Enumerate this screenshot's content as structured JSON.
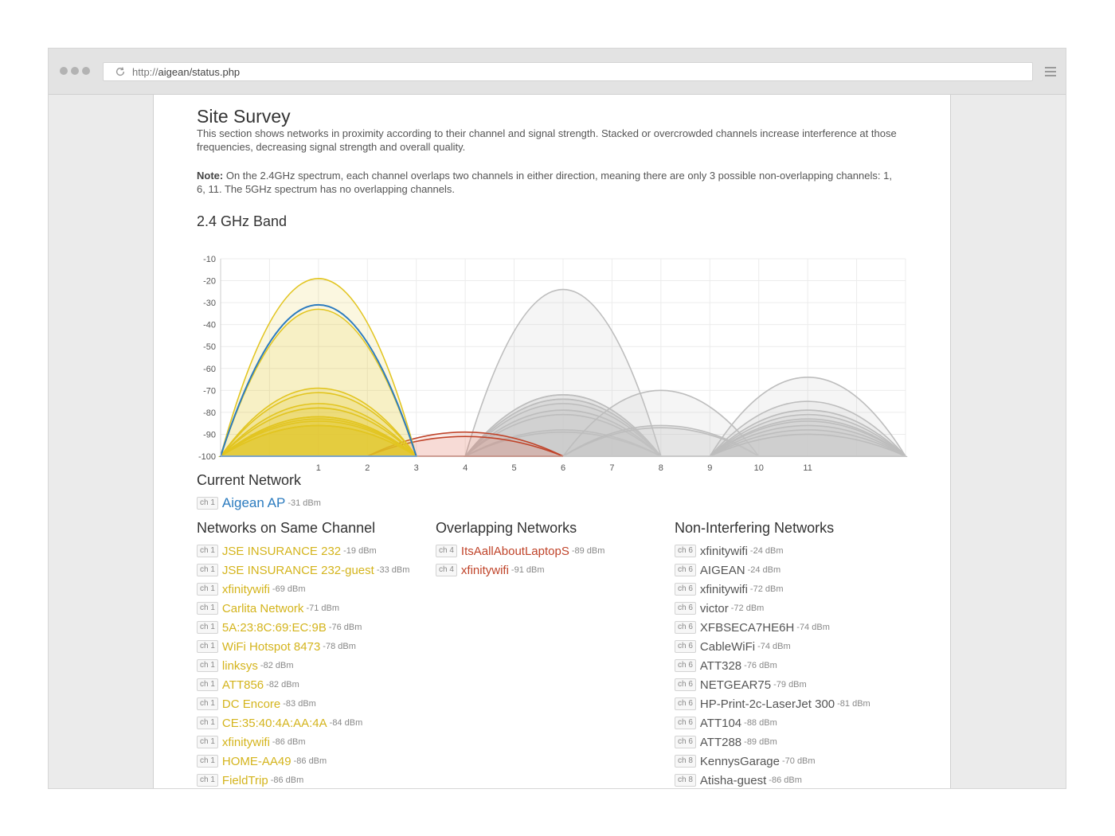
{
  "browser": {
    "url_scheme": "http://",
    "url_host": "aigean/status.php"
  },
  "page": {
    "title": "Site Survey",
    "description": "This section shows networks in proximity according to their channel and signal strength. Stacked or overcrowded channels increase interference at those frequencies, decreasing signal strength and overall quality.",
    "note_label": "Note:",
    "note_text": " On the 2.4GHz spectrum, each channel overlaps two channels in either direction, meaning there are only 3 possible non-overlapping channels: 1, 6, 11. The 5GHz spectrum has no overlapping channels.",
    "band_title": "2.4 GHz Band"
  },
  "colors": {
    "current": "#2b7bbf",
    "same": "#e2c521",
    "overlap": "#c0442a",
    "non_interfering": "#bdbdbd",
    "grid": "#ececec"
  },
  "chart_data": {
    "type": "area",
    "x_ticks": [
      "1",
      "2",
      "3",
      "4",
      "5",
      "6",
      "7",
      "8",
      "9",
      "10",
      "11"
    ],
    "y_ticks": [
      "-10",
      "-20",
      "-30",
      "-40",
      "-50",
      "-60",
      "-70",
      "-80",
      "-90",
      "-100"
    ],
    "xlim": [
      -1,
      13
    ],
    "ylim": [
      -100,
      -10
    ],
    "grid": true,
    "series": [
      {
        "channel": 1,
        "dbm": -19,
        "group": "same"
      },
      {
        "channel": 1,
        "dbm": -33,
        "group": "same"
      },
      {
        "channel": 1,
        "dbm": -69,
        "group": "same"
      },
      {
        "channel": 1,
        "dbm": -71,
        "group": "same"
      },
      {
        "channel": 1,
        "dbm": -76,
        "group": "same"
      },
      {
        "channel": 1,
        "dbm": -78,
        "group": "same"
      },
      {
        "channel": 1,
        "dbm": -82,
        "group": "same"
      },
      {
        "channel": 1,
        "dbm": -82,
        "group": "same"
      },
      {
        "channel": 1,
        "dbm": -83,
        "group": "same"
      },
      {
        "channel": 1,
        "dbm": -84,
        "group": "same"
      },
      {
        "channel": 1,
        "dbm": -86,
        "group": "same"
      },
      {
        "channel": 1,
        "dbm": -86,
        "group": "same"
      },
      {
        "channel": 1,
        "dbm": -86,
        "group": "same"
      },
      {
        "channel": 1,
        "dbm": -31,
        "group": "current"
      },
      {
        "channel": 4,
        "dbm": -89,
        "group": "overlap"
      },
      {
        "channel": 4,
        "dbm": -91,
        "group": "overlap"
      },
      {
        "channel": 6,
        "dbm": -24,
        "group": "non"
      },
      {
        "channel": 6,
        "dbm": -72,
        "group": "non"
      },
      {
        "channel": 6,
        "dbm": -72,
        "group": "non"
      },
      {
        "channel": 6,
        "dbm": -74,
        "group": "non"
      },
      {
        "channel": 6,
        "dbm": -74,
        "group": "non"
      },
      {
        "channel": 6,
        "dbm": -76,
        "group": "non"
      },
      {
        "channel": 6,
        "dbm": -79,
        "group": "non"
      },
      {
        "channel": 6,
        "dbm": -81,
        "group": "non"
      },
      {
        "channel": 6,
        "dbm": -88,
        "group": "non"
      },
      {
        "channel": 6,
        "dbm": -89,
        "group": "non"
      },
      {
        "channel": 8,
        "dbm": -70,
        "group": "non"
      },
      {
        "channel": 8,
        "dbm": -86,
        "group": "non"
      },
      {
        "channel": 8,
        "dbm": -87,
        "group": "non"
      },
      {
        "channel": 11,
        "dbm": -64,
        "group": "non"
      },
      {
        "channel": 11,
        "dbm": -75,
        "group": "non"
      },
      {
        "channel": 11,
        "dbm": -79,
        "group": "non"
      },
      {
        "channel": 11,
        "dbm": -81,
        "group": "non"
      },
      {
        "channel": 11,
        "dbm": -83,
        "group": "non"
      },
      {
        "channel": 11,
        "dbm": -84,
        "group": "non"
      },
      {
        "channel": 11,
        "dbm": -86,
        "group": "non"
      },
      {
        "channel": 11,
        "dbm": -88,
        "group": "non"
      },
      {
        "channel": 11,
        "dbm": -90,
        "group": "non"
      }
    ]
  },
  "current_network": {
    "title": "Current Network",
    "channel": "ch 1",
    "name": "Aigean AP",
    "dbm": "-31 dBm"
  },
  "same_channel": {
    "title": "Networks on Same Channel",
    "items": [
      {
        "channel": "ch 1",
        "name": "JSE INSURANCE 232",
        "dbm": "-19 dBm"
      },
      {
        "channel": "ch 1",
        "name": "JSE INSURANCE 232-guest",
        "dbm": "-33 dBm"
      },
      {
        "channel": "ch 1",
        "name": "xfinitywifi",
        "dbm": "-69 dBm"
      },
      {
        "channel": "ch 1",
        "name": "Carlita Network",
        "dbm": "-71 dBm"
      },
      {
        "channel": "ch 1",
        "name": "5A:23:8C:69:EC:9B",
        "dbm": "-76 dBm"
      },
      {
        "channel": "ch 1",
        "name": "WiFi Hotspot 8473",
        "dbm": "-78 dBm"
      },
      {
        "channel": "ch 1",
        "name": "linksys",
        "dbm": "-82 dBm"
      },
      {
        "channel": "ch 1",
        "name": "ATT856",
        "dbm": "-82 dBm"
      },
      {
        "channel": "ch 1",
        "name": "DC Encore",
        "dbm": "-83 dBm"
      },
      {
        "channel": "ch 1",
        "name": "CE:35:40:4A:AA:4A",
        "dbm": "-84 dBm"
      },
      {
        "channel": "ch 1",
        "name": "xfinitywifi",
        "dbm": "-86 dBm"
      },
      {
        "channel": "ch 1",
        "name": "HOME-AA49",
        "dbm": "-86 dBm"
      },
      {
        "channel": "ch 1",
        "name": "FieldTrip",
        "dbm": "-86 dBm"
      }
    ]
  },
  "overlapping": {
    "title": "Overlapping Networks",
    "items": [
      {
        "channel": "ch 4",
        "name": "ItsAallAboutLaptopS",
        "dbm": "-89 dBm"
      },
      {
        "channel": "ch 4",
        "name": "xfinitywifi",
        "dbm": "-91 dBm"
      }
    ]
  },
  "non_interfering": {
    "title": "Non-Interfering Networks",
    "items": [
      {
        "channel": "ch 6",
        "name": "xfinitywifi",
        "dbm": "-24 dBm"
      },
      {
        "channel": "ch 6",
        "name": "AIGEAN",
        "dbm": "-24 dBm"
      },
      {
        "channel": "ch 6",
        "name": "xfinitywifi",
        "dbm": "-72 dBm"
      },
      {
        "channel": "ch 6",
        "name": "victor",
        "dbm": "-72 dBm"
      },
      {
        "channel": "ch 6",
        "name": "XFBSECA7HE6H",
        "dbm": "-74 dBm"
      },
      {
        "channel": "ch 6",
        "name": "CableWiFi",
        "dbm": "-74 dBm"
      },
      {
        "channel": "ch 6",
        "name": "ATT328",
        "dbm": "-76 dBm"
      },
      {
        "channel": "ch 6",
        "name": "NETGEAR75",
        "dbm": "-79 dBm"
      },
      {
        "channel": "ch 6",
        "name": "HP-Print-2c-LaserJet 300",
        "dbm": "-81 dBm"
      },
      {
        "channel": "ch 6",
        "name": "ATT104",
        "dbm": "-88 dBm"
      },
      {
        "channel": "ch 6",
        "name": "ATT288",
        "dbm": "-89 dBm"
      },
      {
        "channel": "ch 8",
        "name": "KennysGarage",
        "dbm": "-70 dBm"
      },
      {
        "channel": "ch 8",
        "name": "Atisha-guest",
        "dbm": "-86 dBm"
      }
    ]
  }
}
